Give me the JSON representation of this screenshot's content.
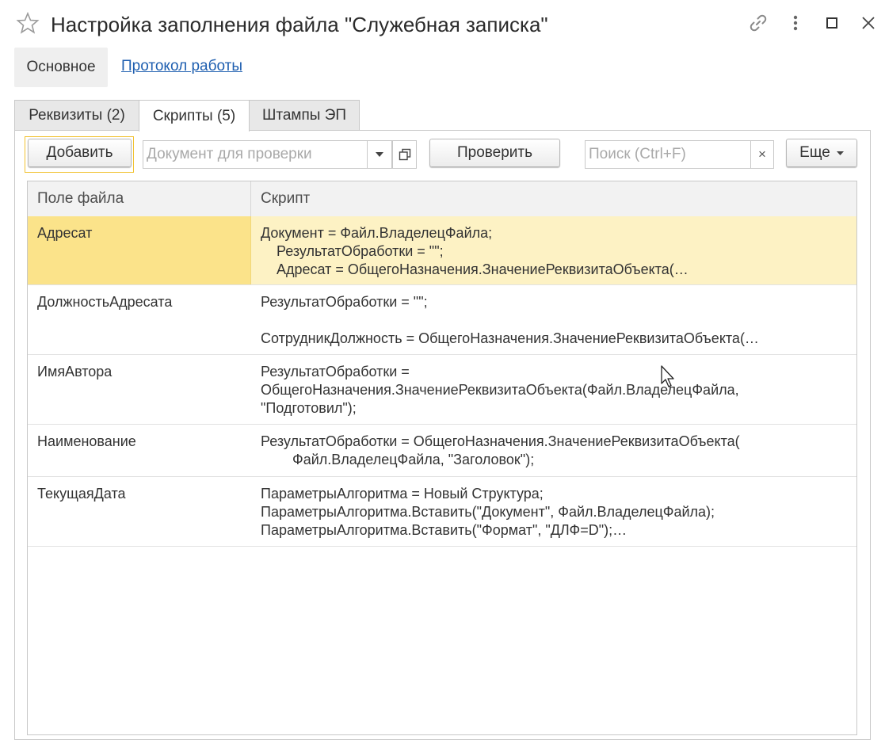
{
  "window": {
    "title": "Настройка заполнения файла \"Служебная записка\""
  },
  "nav": {
    "main": "Основное",
    "log_link": "Протокол работы"
  },
  "tabs": [
    {
      "label": "Реквизиты (2)"
    },
    {
      "label": "Скрипты (5)",
      "active": true
    },
    {
      "label": "Штампы ЭП"
    }
  ],
  "toolbar": {
    "add_label": "Добавить",
    "document_placeholder": "Документ для проверки",
    "check_label": "Проверить",
    "search_placeholder": "Поиск (Ctrl+F)",
    "search_clear": "×",
    "more_label": "Еще"
  },
  "table": {
    "columns": [
      "Поле файла",
      "Скрипт"
    ],
    "rows": [
      {
        "field": "Адресат",
        "script": "Документ = Файл.ВладелецФайла;\n    РезультатОбработки = \"\";\n    Адресат = ОбщегоНазначения.ЗначениеРеквизитаОбъекта(…",
        "selected": true
      },
      {
        "field": "ДолжностьАдресата",
        "script": "РезультатОбработки = \"\";\n\nСотрудникДолжность = ОбщегоНазначения.ЗначениеРеквизитаОбъекта(…"
      },
      {
        "field": "ИмяАвтора",
        "script": "РезультатОбработки =\nОбщегоНазначения.ЗначениеРеквизитаОбъекта(Файл.ВладелецФайла,\n\"Подготовил\");"
      },
      {
        "field": "Наименование",
        "script": "РезультатОбработки = ОбщегоНазначения.ЗначениеРеквизитаОбъекта(\n        Файл.ВладелецФайла, \"Заголовок\");"
      },
      {
        "field": "ТекущаяДата",
        "script": "ПараметрыАлгоритма = Новый Структура;\nПараметрыАлгоритма.Вставить(\"Документ\", Файл.ВладелецФайла);\nПараметрыАлгоритма.Вставить(\"Формат\", \"ДЛФ=D\");…"
      }
    ]
  },
  "colors": {
    "link": "#1f5fb0",
    "selected_field_bg": "#fbe38a",
    "selected_script_bg": "#fdf2c4",
    "focus_border": "#f1c232"
  },
  "icons": {
    "favorite": "star-icon",
    "link": "link-icon",
    "menu": "more-vertical-icon",
    "maximize": "maximize-icon",
    "close": "close-icon",
    "dropdown": "chevron-down-icon",
    "open": "open-form-icon"
  }
}
